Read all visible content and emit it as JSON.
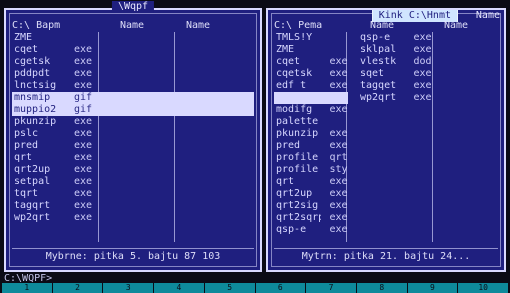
{
  "left_panel": {
    "title": "\\Wqpf",
    "drive_label": "C:\\ Bapm",
    "col1": "Name",
    "col2": "Name",
    "files": [
      {
        "name": "ZME",
        "ext": ""
      },
      {
        "name": "cqet",
        "ext": "exe"
      },
      {
        "name": "cgetsk",
        "ext": "exe"
      },
      {
        "name": "pddpdt",
        "ext": "exe"
      },
      {
        "name": "lnctsig",
        "ext": "exe"
      },
      {
        "name": "mnsmip",
        "ext": "gif"
      },
      {
        "name": "muppio2",
        "ext": "gif"
      },
      {
        "name": "pkunzip",
        "ext": "exe"
      },
      {
        "name": "pslc",
        "ext": "exe"
      },
      {
        "name": "pred",
        "ext": "exe"
      },
      {
        "name": "qrt",
        "ext": "exe"
      },
      {
        "name": "qrt2up",
        "ext": "exe"
      },
      {
        "name": "setpal",
        "ext": "exe"
      },
      {
        "name": "tqrt",
        "ext": "exe"
      },
      {
        "name": "tagqrt",
        "ext": "exe"
      },
      {
        "name": "wp2qrt",
        "ext": "exe"
      }
    ],
    "status": "Mybrne: pitka 5. bajtu 87 103"
  },
  "right_panel": {
    "title_chip": "Kink C:\\Hnmt",
    "title_chip_right": "Name",
    "drive_label": "C:\\ Pema",
    "col1": "Name",
    "col2": "Name",
    "files_left": [
      {
        "name": "TMLS!Y",
        "ext": ""
      },
      {
        "name": "ZME",
        "ext": ""
      },
      {
        "name": "cqet",
        "ext": "exe"
      },
      {
        "name": "cqetsk",
        "ext": "exe"
      },
      {
        "name": "edf t",
        "ext": "exe"
      },
      {
        "name": "",
        "ext": ""
      },
      {
        "name": "modifg",
        "ext": "exe"
      },
      {
        "name": "palette",
        "ext": ""
      },
      {
        "name": "pkunzip",
        "ext": "exe"
      },
      {
        "name": "pred",
        "ext": "exe"
      },
      {
        "name": "profile",
        "ext": "qrt"
      },
      {
        "name": "profile",
        "ext": "sty"
      },
      {
        "name": "qrt",
        "ext": "exe"
      },
      {
        "name": "qrt2up",
        "ext": "exe"
      },
      {
        "name": "qrt2sig",
        "ext": "exe"
      },
      {
        "name": "qrt2sqrp",
        "ext": "exe"
      },
      {
        "name": "qsp-e",
        "ext": "exe"
      }
    ],
    "files_right": [
      {
        "name": "qsp-e",
        "ext": "exe"
      },
      {
        "name": "sklpal",
        "ext": "exe"
      },
      {
        "name": "vlestk",
        "ext": "dod"
      },
      {
        "name": "sqet",
        "ext": "exe"
      },
      {
        "name": "tagqet",
        "ext": "exe"
      },
      {
        "name": "wp2qrt",
        "ext": "exe"
      }
    ],
    "status": "Mytrn: pitka 21. bajtu 24..."
  },
  "cmdline": {
    "text": "C:\\WQPF>"
  },
  "fkeys": [
    {
      "label": "1"
    },
    {
      "label": "2"
    },
    {
      "label": "3"
    },
    {
      "label": "4"
    },
    {
      "label": "5"
    },
    {
      "label": "6"
    },
    {
      "label": "7"
    },
    {
      "label": "8"
    },
    {
      "label": "9"
    },
    {
      "label": "10"
    }
  ]
}
